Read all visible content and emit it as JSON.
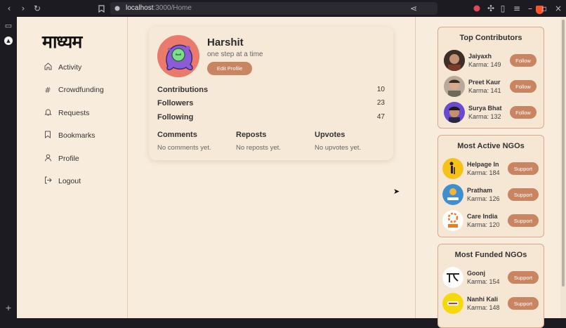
{
  "browser": {
    "url_host": "localhost",
    "url_path": ":3000/Home"
  },
  "logo": {
    "text": "माध्यम"
  },
  "nav": {
    "items": [
      {
        "label": "Activity",
        "icon": "home-icon"
      },
      {
        "label": "Crowdfunding",
        "icon": "hashtag-icon"
      },
      {
        "label": "Requests",
        "icon": "bell-icon"
      },
      {
        "label": "Bookmarks",
        "icon": "bookmark-icon"
      },
      {
        "label": "Profile",
        "icon": "user-icon"
      },
      {
        "label": "Logout",
        "icon": "logout-icon"
      }
    ]
  },
  "profile": {
    "name": "Harshit",
    "tagline": "one step at a time",
    "edit_label": "Edit Profile",
    "stats": [
      {
        "label": "Contributions",
        "value": "10"
      },
      {
        "label": "Followers",
        "value": "23"
      },
      {
        "label": "Following",
        "value": "47"
      }
    ],
    "sections": [
      {
        "title": "Comments",
        "empty": "No comments yet."
      },
      {
        "title": "Reposts",
        "empty": "No reposts yet."
      },
      {
        "title": "Upvotes",
        "empty": "No upvotes yet."
      }
    ]
  },
  "top_contributors": {
    "title": "Top Contributors",
    "button_label": "Follow",
    "items": [
      {
        "name": "Jaiyaxh",
        "karma": "Karma: 149"
      },
      {
        "name": "Preet Kaur",
        "karma": "Karma: 141"
      },
      {
        "name": "Surya Bhat",
        "karma": "Karma: 132"
      }
    ]
  },
  "active_ngos": {
    "title": "Most Active NGOs",
    "button_label": "Support",
    "items": [
      {
        "name": "Helpage In",
        "karma": "Karma: 184"
      },
      {
        "name": "Pratham",
        "karma": "Karma: 126"
      },
      {
        "name": "Care India",
        "karma": "Karma: 120"
      }
    ]
  },
  "funded_ngos": {
    "title": "Most Funded NGOs",
    "button_label": "Support",
    "items": [
      {
        "name": "Goonj",
        "karma": "Karma: 154"
      },
      {
        "name": "Nanhi Kali",
        "karma": "Karma: 148"
      }
    ]
  },
  "colors": {
    "accent": "#c98462",
    "background": "#f8ecdd",
    "panel_border": "#d9a88b"
  }
}
